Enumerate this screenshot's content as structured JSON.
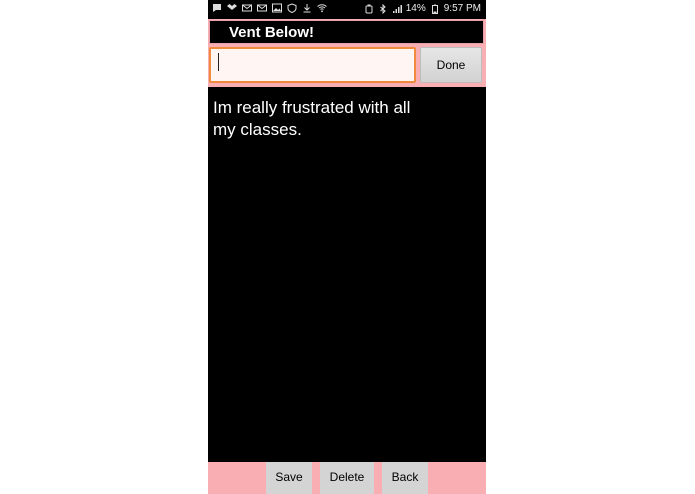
{
  "status_bar": {
    "left_icons": [
      "message-icon",
      "dropbox-icon",
      "mail-icon",
      "mail-icon",
      "image-icon",
      "shield-wifi-icon",
      "download-icon",
      "wifi-icon"
    ],
    "battery": "14%",
    "time": "9:57 PM"
  },
  "header": {
    "title": "Vent Below!"
  },
  "input": {
    "value": "",
    "placeholder": ""
  },
  "done_button": {
    "label": "Done"
  },
  "vent": {
    "text": "Im really frustrated with all my classes."
  },
  "bottom_bar": {
    "save_label": "Save",
    "delete_label": "Delete",
    "back_label": "Back"
  },
  "colors": {
    "accent_pink": "#f9aeb4",
    "input_focus_border": "#f08a3c",
    "background": "#000000"
  }
}
